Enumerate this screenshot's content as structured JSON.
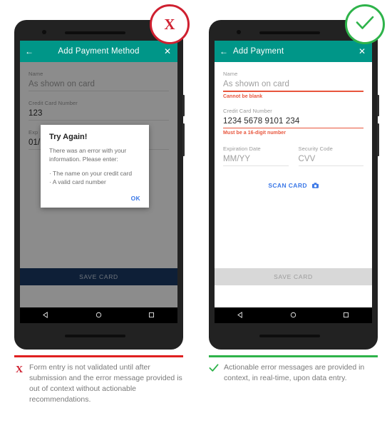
{
  "left": {
    "appbar": {
      "back_icon": "arrow-left-icon",
      "title": "Add Payment Method",
      "close_icon": "close-icon"
    },
    "fields": [
      {
        "label": "Name",
        "value": "As shown on card"
      },
      {
        "label": "Credit Card Number",
        "value": "123"
      },
      {
        "label": "Exp",
        "value": "01/"
      }
    ],
    "dialog": {
      "title": "Try Again!",
      "body": "There was an error with your information. Please enter:",
      "items": [
        "The name on your credit card",
        "A valid card number"
      ],
      "ok_label": "OK"
    },
    "save_label": "SAVE CARD",
    "badge_icon": "x-mark-icon",
    "badge_symbol": "X",
    "caption": "Form entry is not validated until after submission and the error message provided is out of context without actionable recommendations.",
    "rule_color": "#e02020",
    "save_color": "#1b3a64"
  },
  "right": {
    "appbar": {
      "back_icon": "arrow-left-icon",
      "title": "Add Payment",
      "close_icon": "close-icon"
    },
    "name_field": {
      "label": "Name",
      "value": "As shown on card",
      "error": "Cannot be blank"
    },
    "card_field": {
      "label": "Credit Card Number",
      "value": "1234 5678 9101 234",
      "error": "Must be a 16-digit number"
    },
    "expiration_field": {
      "label": "Expiration Date",
      "value": "MM/YY"
    },
    "security_field": {
      "label": "Security Code",
      "value": "CVV"
    },
    "scan": {
      "label": "SCAN CARD",
      "icon": "camera-icon"
    },
    "save_label": "SAVE CARD",
    "badge_icon": "check-mark-icon",
    "caption": "Actionable error messages are provided in context, in real-time, upon data entry.",
    "rule_color": "#2eb34a",
    "error_color": "#e8553c"
  },
  "nav": {
    "back_icon": "nav-back-triangle-icon",
    "home_icon": "nav-home-circle-icon",
    "recents_icon": "nav-recents-square-icon"
  },
  "theme": {
    "appbar_color": "#009688",
    "link_color": "#3b78e7"
  }
}
